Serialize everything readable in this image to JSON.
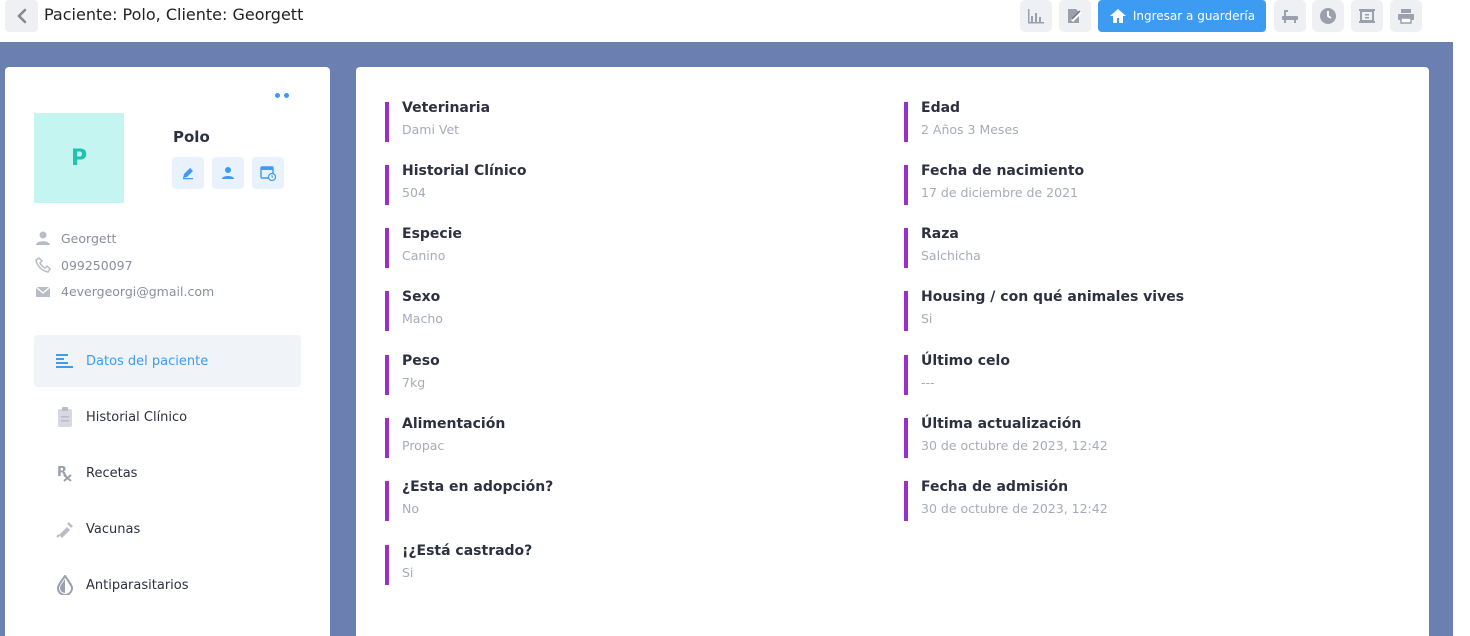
{
  "header": {
    "title": "Paciente: Polo, Cliente: Georgett",
    "primary_button": "Ingresar a guardería"
  },
  "patient": {
    "initial": "P",
    "name": "Polo",
    "owner": "Georgett",
    "phone": "099250097",
    "email": "4evergeorgi@gmail.com"
  },
  "menu": [
    {
      "label": "Datos del paciente",
      "icon": "list-icon",
      "active": true
    },
    {
      "label": "Historial Clínico",
      "icon": "clipboard-icon",
      "active": false
    },
    {
      "label": "Recetas",
      "icon": "prescription-icon",
      "active": false
    },
    {
      "label": "Vacunas",
      "icon": "syringe-icon",
      "active": false
    },
    {
      "label": "Antiparasitarios",
      "icon": "drop-icon",
      "active": false
    }
  ],
  "details_left": [
    {
      "label": "Veterinaria",
      "value": "Dami Vet"
    },
    {
      "label": "Historial Clínico",
      "value": "504"
    },
    {
      "label": "Especie",
      "value": "Canino"
    },
    {
      "label": "Sexo",
      "value": "Macho"
    },
    {
      "label": "Peso",
      "value": "7kg"
    },
    {
      "label": "Alimentación",
      "value": "Propac"
    },
    {
      "label": "¿Esta en adopción?",
      "value": "No"
    },
    {
      "label": "¡¿Está castrado?",
      "value": "Si"
    }
  ],
  "details_right": [
    {
      "label": "Edad",
      "value": "2 Años 3 Meses"
    },
    {
      "label": "Fecha de nacimiento",
      "value": "17 de diciembre de 2021"
    },
    {
      "label": "Raza",
      "value": "Salchicha"
    },
    {
      "label": "Housing / con qué animales vives",
      "value": "Si"
    },
    {
      "label": "Último celo",
      "value": "---"
    },
    {
      "label": "Última actualización",
      "value": "30 de octubre de 2023, 12:42"
    },
    {
      "label": "Fecha de admisión",
      "value": "30 de octubre de 2023, 12:42"
    }
  ],
  "colors": {
    "accent": "#3d9bf2",
    "field_bar": "#9b30c8",
    "background": "#6b7fb0",
    "avatar_bg": "#c5f5f0"
  }
}
